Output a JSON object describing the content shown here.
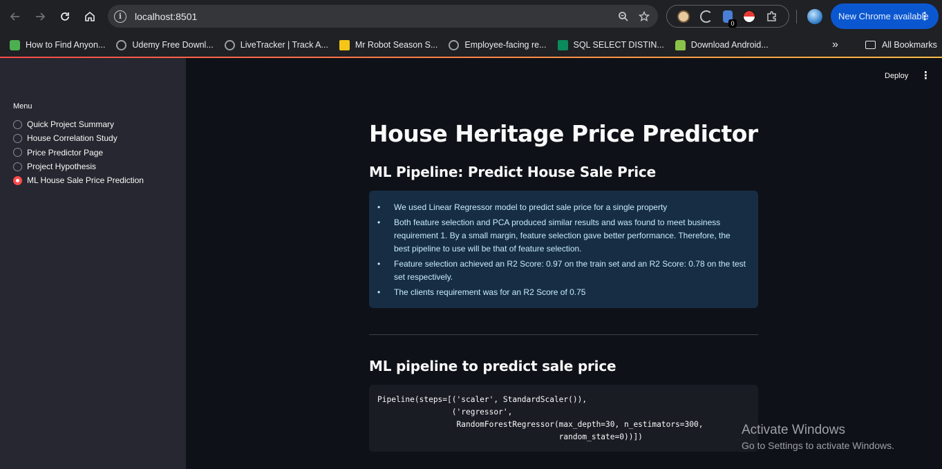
{
  "browser": {
    "url": "localhost:8501",
    "update_button": "New Chrome available",
    "extension_badge": "0",
    "bookmarks": [
      "How to Find Anyon...",
      "Udemy Free Downl...",
      "LiveTracker | Track A...",
      "Mr Robot Season S...",
      "Employee-facing re...",
      "SQL SELECT DISTIN...",
      "Download Android..."
    ],
    "all_bookmarks": "All Bookmarks"
  },
  "sidebar": {
    "menu_label": "Menu",
    "items": [
      {
        "label": "Quick Project Summary",
        "selected": false
      },
      {
        "label": "House Correlation Study",
        "selected": false
      },
      {
        "label": "Price Predictor Page",
        "selected": false
      },
      {
        "label": "Project Hypothesis",
        "selected": false
      },
      {
        "label": "ML House Sale Price Prediction",
        "selected": true
      }
    ]
  },
  "header": {
    "deploy": "Deploy"
  },
  "main": {
    "title": "House Heritage Price Predictor",
    "subtitle": "ML Pipeline: Predict House Sale Price",
    "bullets": [
      "We used Linear Regressor model to predict sale price for a single property",
      "Both feature selection and PCA produced similar results and was found to meet business requirement 1. By a small margin, feature selection gave better performance. Therefore, the best pipeline to use will be that of feature selection.",
      "Feature selection achieved an R2 Score: 0.97 on the train set and an R2 Score: 0.78 on the test set respectively.",
      "The clients requirement was for an R2 Score of 0.75"
    ],
    "section_title": "ML pipeline to predict sale price",
    "code": "Pipeline(steps=[('scaler', StandardScaler()),\n                ('regressor',\n                 RandomForestRegressor(max_depth=30, n_estimators=300,\n                                       random_state=0))])"
  },
  "watermark": {
    "title": "Activate Windows",
    "subtitle": "Go to Settings to activate Windows."
  },
  "colors": {
    "accent": "#ff4b4b",
    "info_bg": "#172d43",
    "chrome_update": "#0b57d0"
  }
}
